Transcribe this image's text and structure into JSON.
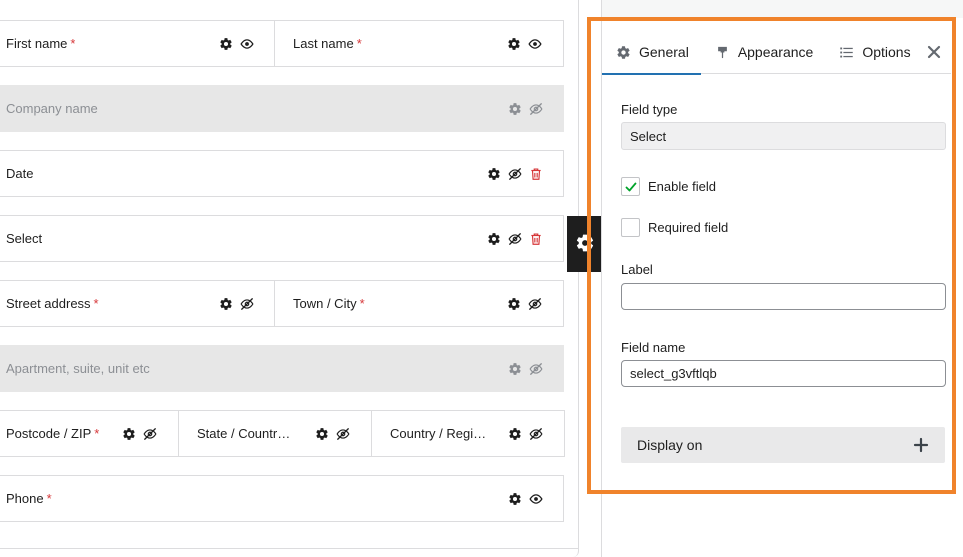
{
  "builder": {
    "rows": [
      {
        "fields": [
          {
            "label": "First name",
            "required": "*",
            "visible": true,
            "deletable": false
          },
          {
            "label": "Last name",
            "required": "*",
            "visible": true,
            "deletable": false
          }
        ]
      },
      {
        "fields": [
          {
            "label": "Company name",
            "required": "",
            "visible": false,
            "deletable": false,
            "disabled": true
          }
        ]
      },
      {
        "fields": [
          {
            "label": "Date",
            "required": "",
            "visible": false,
            "deletable": true
          }
        ]
      },
      {
        "fields": [
          {
            "label": "Select",
            "required": "",
            "visible": false,
            "deletable": true
          }
        ]
      },
      {
        "fields": [
          {
            "label": "Street address",
            "required": "*",
            "visible": false,
            "deletable": false
          },
          {
            "label": "Town / City",
            "required": "*",
            "visible": false,
            "deletable": false
          }
        ]
      },
      {
        "fields": [
          {
            "label": "Apartment, suite, unit etc",
            "required": "",
            "visible": false,
            "deletable": false,
            "disabled": true
          }
        ]
      },
      {
        "fields": [
          {
            "label": "Postcode / ZIP",
            "required": "*",
            "visible": false,
            "deletable": false
          },
          {
            "label": "State / Countr…",
            "required": "",
            "visible": false,
            "deletable": false
          },
          {
            "label": "Country / Regi…",
            "required": "",
            "visible": false,
            "deletable": false
          }
        ]
      },
      {
        "fields": [
          {
            "label": "Phone",
            "required": "*",
            "visible": true,
            "deletable": false
          }
        ]
      }
    ],
    "side_gear_icon": "gear-icon"
  },
  "panel": {
    "tabs": [
      {
        "label": "General",
        "icon": "gear-icon",
        "active": true
      },
      {
        "label": "Appearance",
        "icon": "paint-brush-icon",
        "active": false
      },
      {
        "label": "Options",
        "icon": "list-icon",
        "active": false
      }
    ],
    "close_icon": "close-icon",
    "field_type": {
      "label": "Field type",
      "value": "Select"
    },
    "enable_field": {
      "label": "Enable field",
      "checked": true
    },
    "required_field": {
      "label": "Required field",
      "checked": false
    },
    "label_field": {
      "label": "Label",
      "value": ""
    },
    "field_name": {
      "label": "Field name",
      "value": "select_g3vftlqb"
    },
    "display_on": {
      "label": "Display on",
      "icon": "plus-icon"
    }
  },
  "colors": {
    "highlight": "#f0832b",
    "accent": "#2271b1",
    "required": "#d63638",
    "check": "#00a32a"
  }
}
